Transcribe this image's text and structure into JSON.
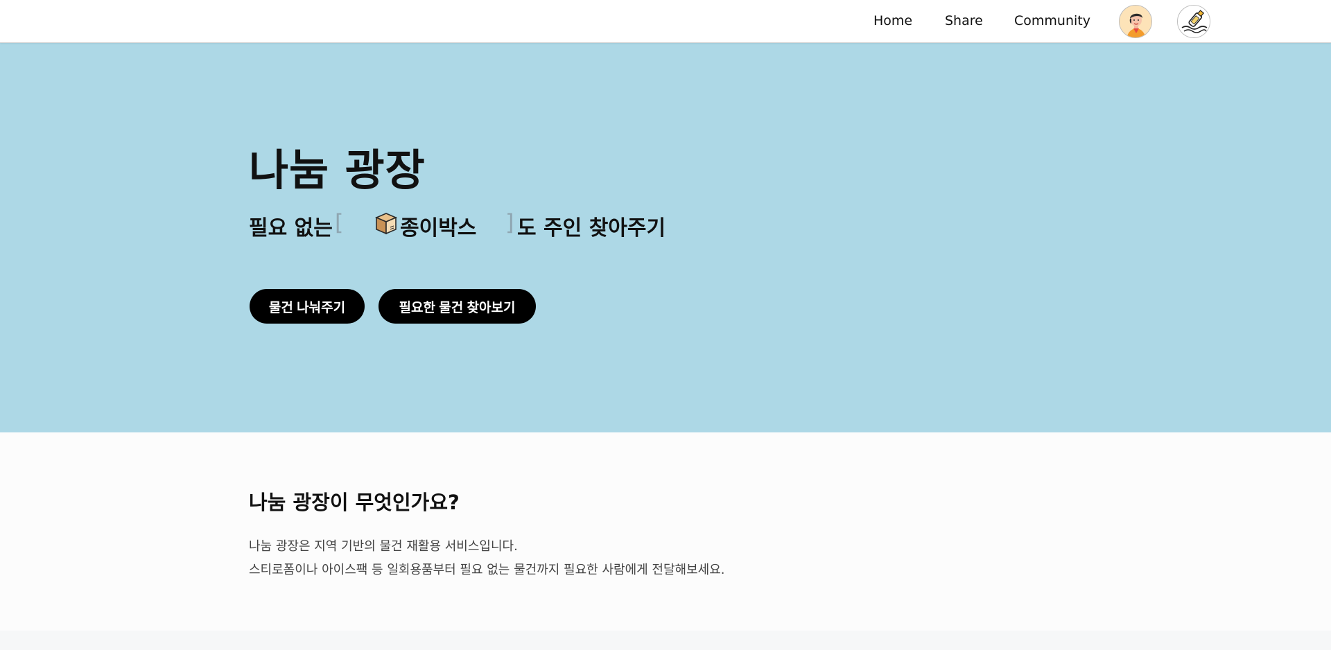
{
  "nav": {
    "links": [
      "Home",
      "Share",
      "Community"
    ],
    "profile_icon": "user-avatar-icon",
    "logo_icon": "bottle-message-logo-icon"
  },
  "hero": {
    "title": "나눔 광장",
    "subtitle_prefix": "필요 없는",
    "bracket_open": "[",
    "item_icon": "cardboard-box-icon",
    "item_label": "종이박스",
    "bracket_close": "]",
    "subtitle_suffix": "도 주인 찾아주기",
    "buttons": [
      "물건 나눠주기",
      "필요한 물건 찾아보기"
    ],
    "background_color": "#add8e6"
  },
  "about": {
    "title": "나눔 광장이 무엇인가요?",
    "lines": [
      "나눔 광장은 지역 기반의 물건 재활용 서비스입니다.",
      "스티로폼이나 아이스팩 등 일회용품부터 필요 없는 물건까지 필요한 사람에게 전달해보세요."
    ]
  }
}
